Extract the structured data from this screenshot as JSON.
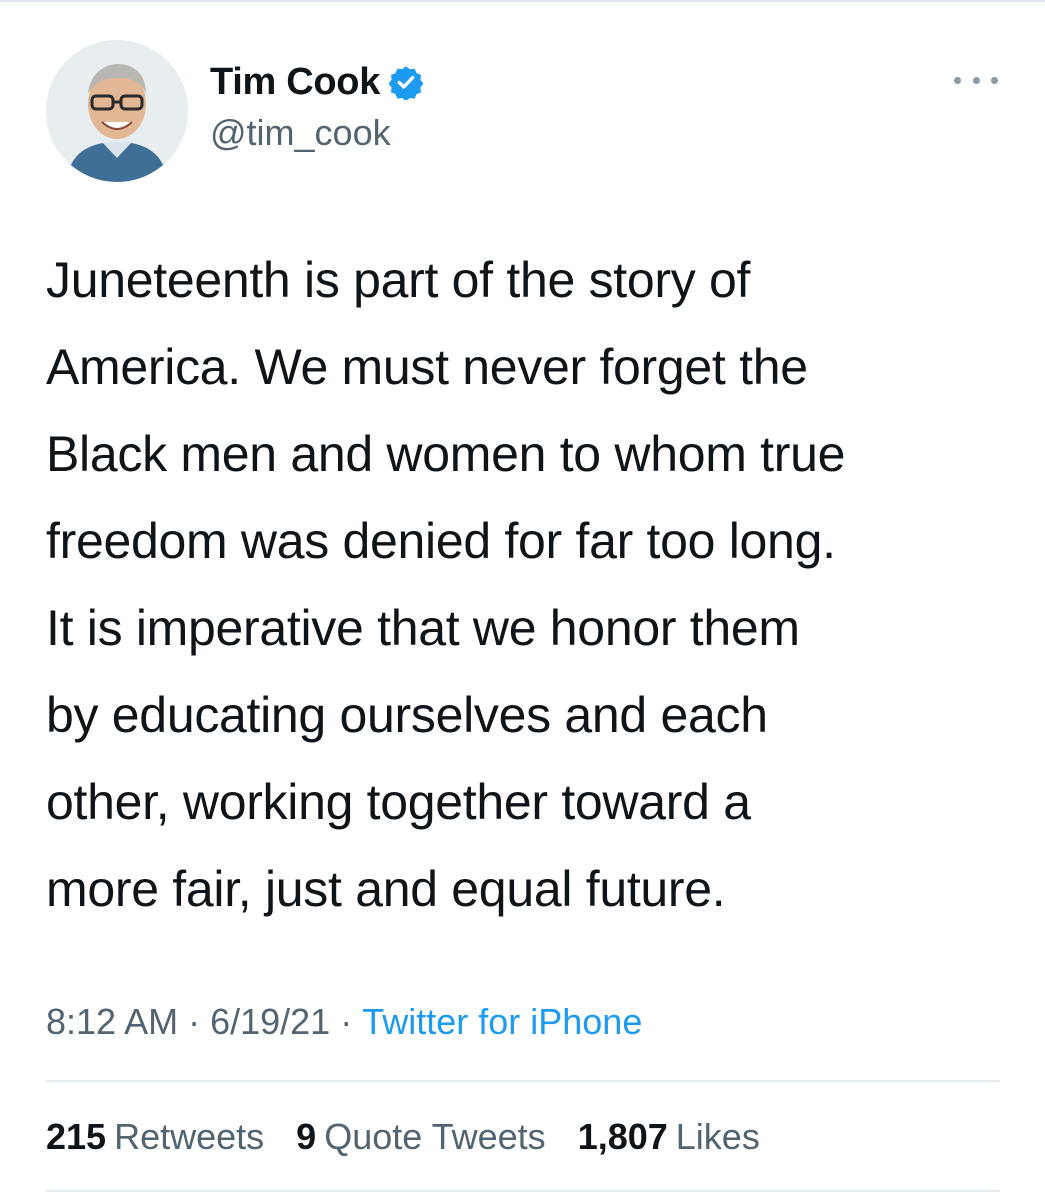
{
  "author": {
    "display_name": "Tim Cook",
    "handle": "@tim_cook",
    "verified": true,
    "verified_color": "#1d9bf0"
  },
  "menu": {
    "more_icon": "more-horizontal-icon"
  },
  "tweet": {
    "lines": [
      "Juneteenth is part of the story of",
      "America. We must never forget the",
      "Black men and women to whom true",
      "freedom was denied for far too long.",
      "It is imperative that we honor them",
      "by educating ourselves and each",
      "other, working together toward a",
      "more fair, just and equal future."
    ]
  },
  "meta": {
    "time": "8:12 AM",
    "separator": "·",
    "date": "6/19/21",
    "source": "Twitter for iPhone",
    "source_color": "#1d9bf0"
  },
  "stats": {
    "retweets_count": "215",
    "retweets_label": "Retweets",
    "quotes_count": "9",
    "quotes_label": "Quote Tweets",
    "likes_count": "1,807",
    "likes_label": "Likes"
  }
}
